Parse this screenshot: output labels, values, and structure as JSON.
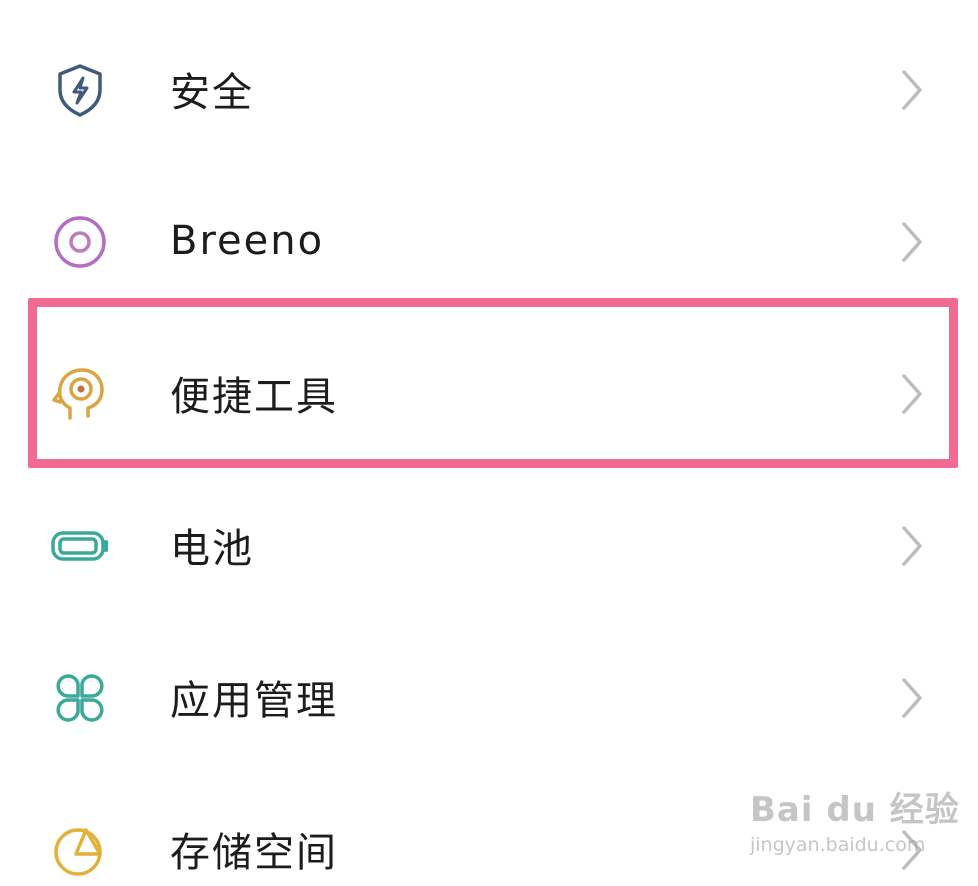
{
  "settings": {
    "items": [
      {
        "label": "安全",
        "icon": "shield-bolt-icon",
        "color": "#3f5b7a"
      },
      {
        "label": "Breeno",
        "icon": "breeno-ring-icon",
        "color": "#b26ec2"
      },
      {
        "label": "便捷工具",
        "icon": "head-target-icon",
        "color": "#d9a441",
        "highlighted": true
      },
      {
        "label": "电池",
        "icon": "battery-icon",
        "color": "#3aa99a"
      },
      {
        "label": "应用管理",
        "icon": "apps-grid-icon",
        "color": "#3aa99a"
      },
      {
        "label": "存储空间",
        "icon": "storage-pie-icon",
        "color": "#e2b13c"
      }
    ]
  },
  "highlight": {
    "color": "#f06a92"
  },
  "watermark": {
    "top": "Bai du 经验",
    "bottom": "jingyan.baidu.com"
  }
}
